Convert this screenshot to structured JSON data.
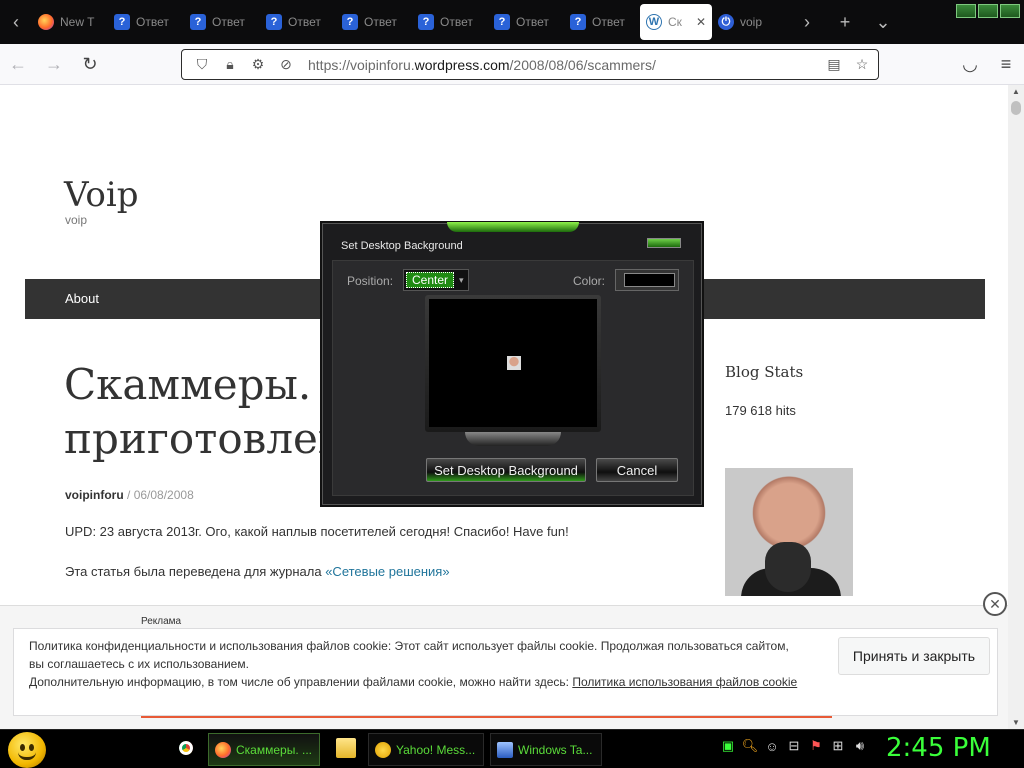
{
  "browser": {
    "tabs": [
      {
        "label": "New T",
        "icon": "firefox-icon"
      },
      {
        "label": "Ответ",
        "icon": "answers-icon"
      },
      {
        "label": "Ответ",
        "icon": "answers-icon"
      },
      {
        "label": "Ответ",
        "icon": "answers-icon"
      },
      {
        "label": "Ответ",
        "icon": "answers-icon"
      },
      {
        "label": "Ответ",
        "icon": "answers-icon"
      },
      {
        "label": "Ответ",
        "icon": "answers-icon"
      },
      {
        "label": "Ответ",
        "icon": "answers-icon"
      },
      {
        "label": "Ск",
        "icon": "wordpress-icon",
        "active": true
      },
      {
        "label": "voip",
        "icon": "voip-icon"
      }
    ],
    "url_host": "https://voipinforu.",
    "url_domain": "wordpress.com",
    "url_path": "/2008/08/06/scammers/"
  },
  "site": {
    "title": "Voip",
    "description": "voip",
    "menu_about": "About"
  },
  "post": {
    "title_line1": "Скаммеры. И",
    "title_line2": "приготовлен",
    "author": "voipinforu",
    "separator": " / ",
    "date": "06/08/2008",
    "p1": "UPD: 23 августа 2013г.  Ого, какой наплыв посетителей сегодня!  Спасибо! Have fun!",
    "p2_text": "Эта статья была переведена для журнала ",
    "p2_link": "«Сетевые решения»"
  },
  "sidebar": {
    "blog_stats": "Blog Stats",
    "hits": "179 618 hits"
  },
  "dialog": {
    "title": "Set Desktop Background",
    "position_label": "Position:",
    "position_value": "Center",
    "color_label": "Color:",
    "set_button": "Set Desktop Background",
    "cancel_button": "Cancel"
  },
  "ad": {
    "label": "Реклама"
  },
  "cookie": {
    "line1": "Политика конфиденциальности и использования файлов cookie: Этот сайт использует файлы cookie. Продолжая пользоваться сайтом, вы соглашаетесь с их использованием.",
    "line2": "Дополнительную информацию, в том числе об управлении файлами cookie, можно найти здесь: ",
    "link": "Политика использования файлов cookie",
    "accept": "Принять и закрыть"
  },
  "taskbar": {
    "items": [
      {
        "label": "Скаммеры. ..."
      },
      {
        "label": "Yahoo! Mess..."
      },
      {
        "label": "Windows Ta..."
      }
    ],
    "clock": "2:45 PM"
  },
  "colors": {
    "accent_green": "#3aff3a",
    "menubar": "#333333",
    "link": "#21759b"
  }
}
